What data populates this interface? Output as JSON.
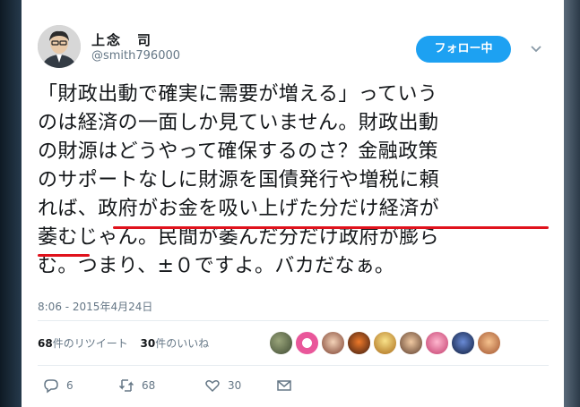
{
  "user": {
    "display_name": "上念　司",
    "screen_name": "@smith796000"
  },
  "follow_button_label": "フォロー中",
  "tweet": {
    "lines": [
      "「財政出動で確実に需要が増える」っていう",
      "のは経済の一面しか見ていません。財政出動",
      "の財源はどうやって確保するのさ？金融政策",
      "のサポートなしに財源を国債発行や増税に頼",
      "れば、",
      "政府がお金を吸い上げた分だけ経済が",
      "萎む",
      "じゃん。民間が萎んだ分だけ政府が膨ら",
      "む。つまり、±０ですよ。バカだなぁ。"
    ],
    "highlight_color": "#e0121c"
  },
  "timestamp": "8:06 - 2015年4月24日",
  "stats": {
    "retweets_count": "68",
    "retweets_label": "件のリツイート",
    "likes_count": "30",
    "likes_label": "件のいいね"
  },
  "actions": {
    "reply_count": "6",
    "retweet_count": "68",
    "like_count": "30"
  },
  "colors": {
    "accent": "#1da1f2",
    "text": "#14171a",
    "muted": "#657786"
  }
}
